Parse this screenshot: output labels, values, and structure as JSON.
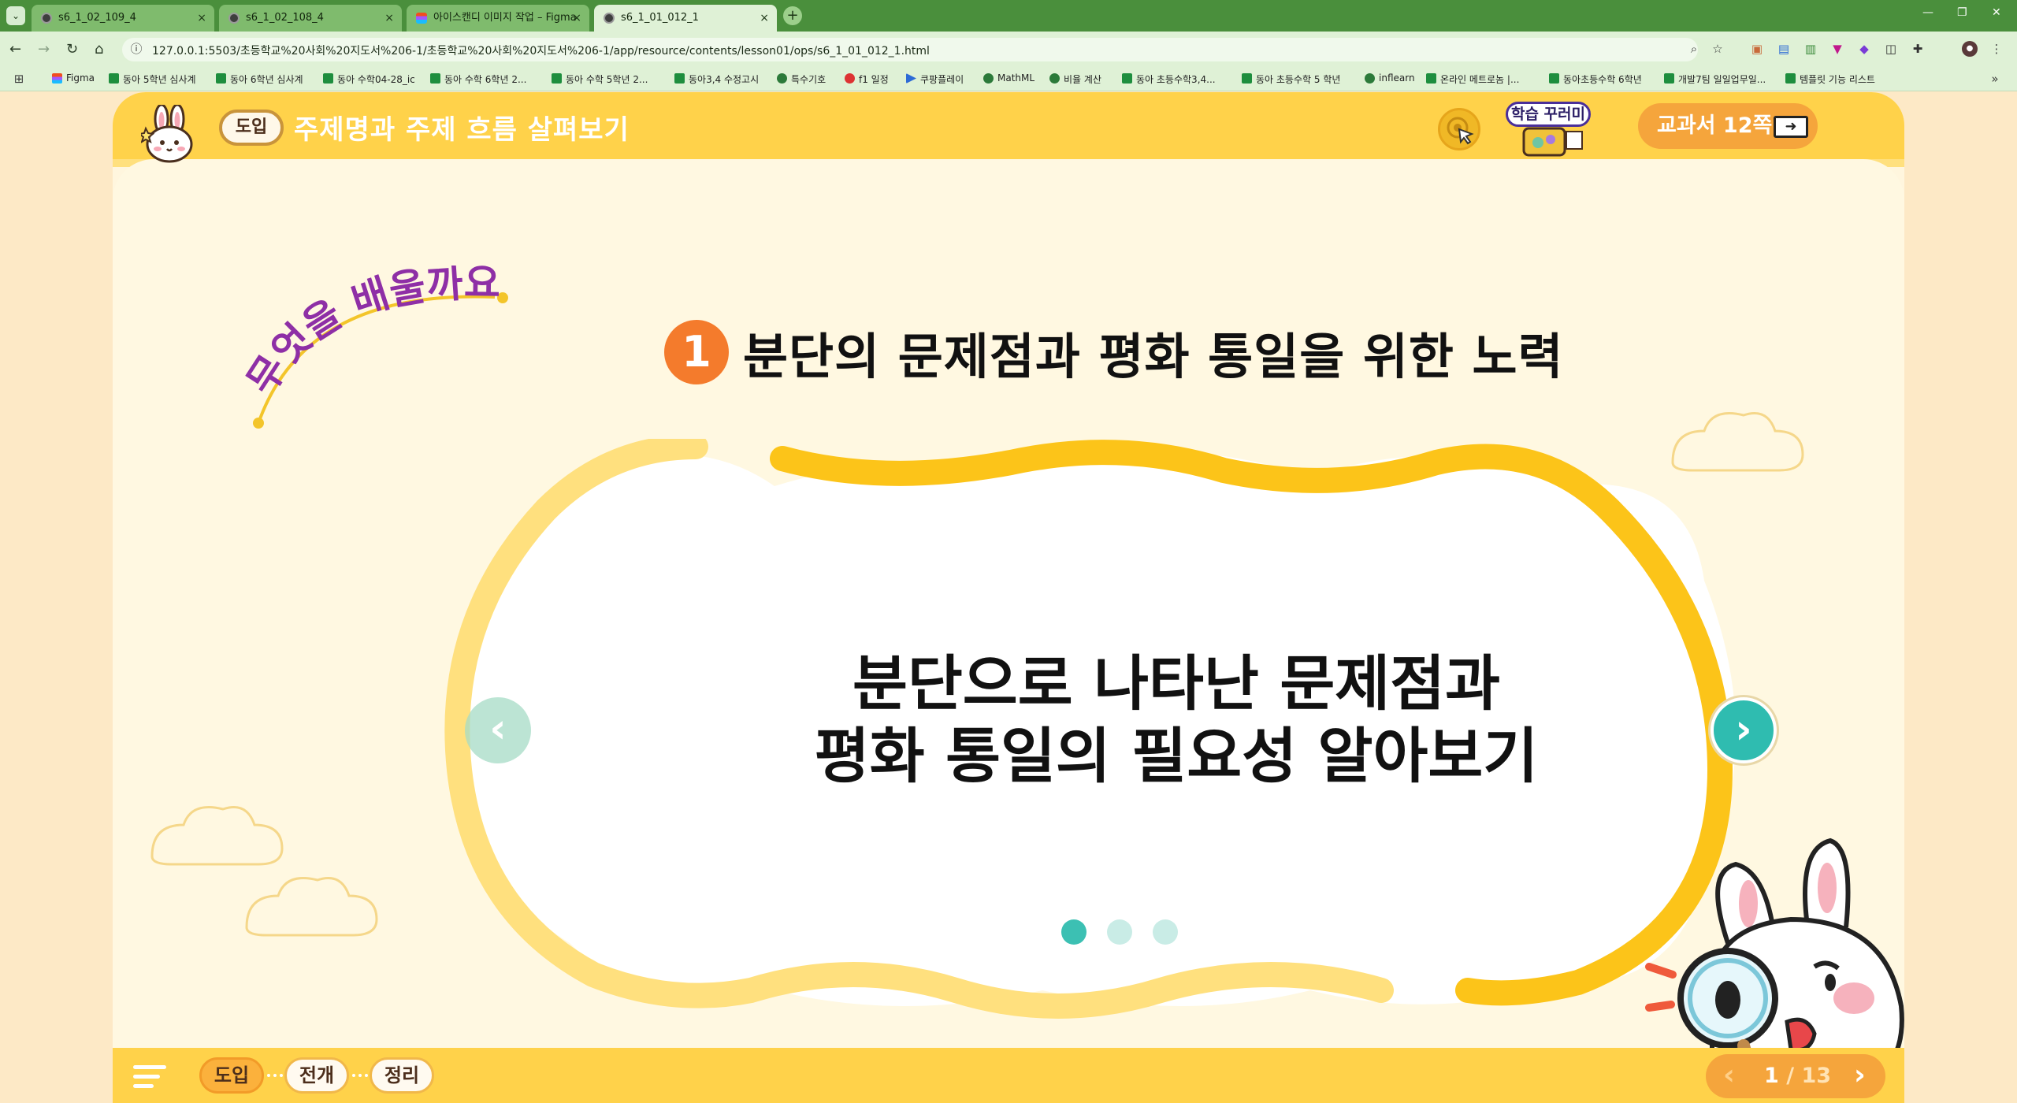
{
  "browser": {
    "tabs": [
      {
        "title": "s6_1_02_109_4",
        "active": false
      },
      {
        "title": "s6_1_02_108_4",
        "active": false
      },
      {
        "title": "아이스캔디 이미지 작업 – Figma",
        "active": false
      },
      {
        "title": "s6_1_01_012_1",
        "active": true
      }
    ],
    "url": "127.0.0.1:5503/초등학교%20사회%20지도서%206-1/초등학교%20사회%20지도서%206-1/app/resource/contents/lesson01/ops/s6_1_01_012_1.html",
    "bookmarks": [
      "Figma",
      "동아 5학년 심사계",
      "동아 6학년 심사계",
      "동아 수학04-28_ic",
      "동아 수학 6학년 2...",
      "동아 수학 5학년 2...",
      "동아3,4 수정고시",
      "특수기호",
      "f1 일정",
      "쿠팡플레이",
      "MathML",
      "비율 계산",
      "동아 초등수학3,4...",
      "동아 초등수학 5 학년",
      "inflearn",
      "온라인 메트로놈 |...",
      "동아초등수학 6학년",
      "개발7팀 일일업무일...",
      "템플릿 기능 리스트"
    ]
  },
  "header": {
    "intro_badge": "도입",
    "title": "주제명과 주제 흐름 살펴보기",
    "study_label": "학습 꾸러미",
    "textbook_button": "교과서 12쪽"
  },
  "main": {
    "arc_title": "무엇을 배울까요?",
    "topic_number": "1",
    "topic_title": "분단의 문제점과 평화 통일을 위한 노력",
    "body_line1": "분단으로 나타난 문제점과",
    "body_line2": "평화 통일의 필요성 알아보기",
    "slide_count": 3,
    "current_slide": 1
  },
  "footer": {
    "steps": [
      "도입",
      "전개",
      "정리"
    ],
    "active_step": "도입",
    "page_current": "1",
    "page_total": "/ 13"
  },
  "colors": {
    "header": "#ffd24a",
    "accent_orange": "#f47b2c",
    "teal": "#2fbcb0",
    "background": "#fff8e1"
  }
}
